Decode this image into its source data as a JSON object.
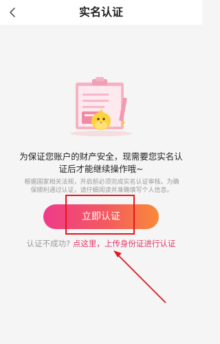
{
  "header": {
    "title": "实名认证"
  },
  "message": {
    "line1": "为保证您账户的财产安全，现需要您实名认",
    "line2": "证后才能继续操作哦~"
  },
  "note": {
    "line1": "根据国家相关法规，开启前必须完成实名认证审核。为确",
    "line2": "保顺利通过认证，请仔细阅读并准确填写个人信息。"
  },
  "button": {
    "label": "立即认证"
  },
  "fail": {
    "question": "认证不成功?",
    "link": "点这里，上传身份证进行认证"
  },
  "colors": {
    "accent": "#e8366a",
    "highlight": "#e5161c"
  }
}
